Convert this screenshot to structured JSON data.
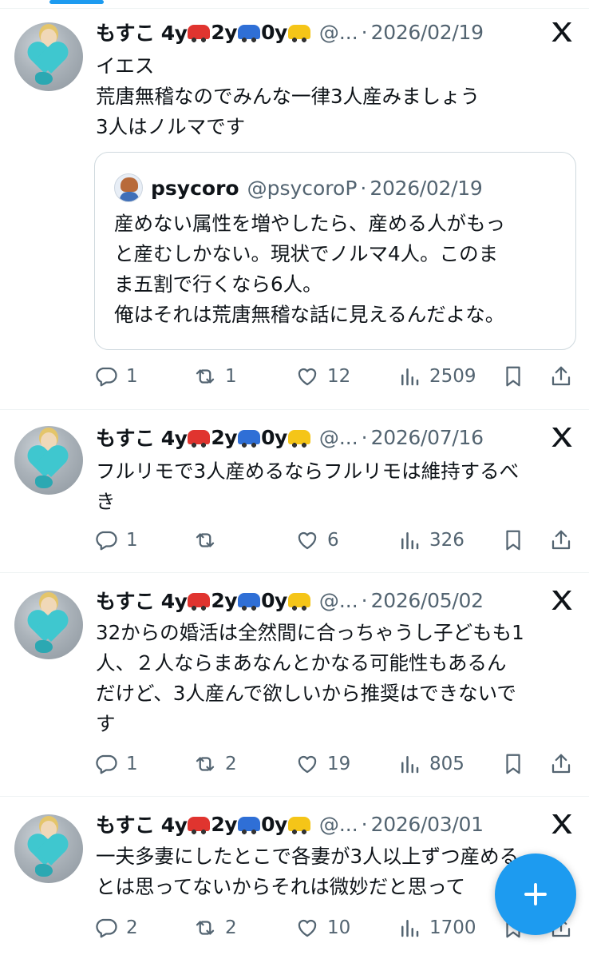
{
  "tweets": [
    {
      "name": "もすこ 4y",
      "name_2y": "2y",
      "name_0y": "0y",
      "handle": "@...",
      "dot": "·",
      "date": "2026/02/19",
      "text": "イエス\n荒唐無稽なのでみんな一律3人産みましょう\n3人はノルマです",
      "quote": {
        "name": "psycoro",
        "handle": "@psycoroP",
        "dot": "·",
        "date": "2026/02/19",
        "text": "産めない属性を増やしたら、産める人がもっ\nと産むしかない。現状でノルマ4人。このま\nま五割で行くなら6人。\n俺はそれは荒唐無稽な話に見えるんだよな。"
      },
      "replies": "1",
      "retweets": "1",
      "likes": "12",
      "views": "2509"
    },
    {
      "name": "もすこ 4y",
      "name_2y": "2y",
      "name_0y": "0y",
      "handle": "@...",
      "dot": "·",
      "date": "2026/07/16",
      "text": "フルリモで3人産めるならフルリモは維持するべ\nき",
      "replies": "1",
      "retweets": "",
      "likes": "6",
      "views": "326"
    },
    {
      "name": "もすこ 4y",
      "name_2y": "2y",
      "name_0y": "0y",
      "handle": "@...",
      "dot": "·",
      "date": "2026/05/02",
      "text": "32からの婚活は全然間に合っちゃうし子どもも1\n人、２人ならまあなんとかなる可能性もあるん\nだけど、3人産んで欲しいから推奨はできないで\nす",
      "replies": "1",
      "retweets": "2",
      "likes": "19",
      "views": "805"
    },
    {
      "name": "もすこ 4y",
      "name_2y": "2y",
      "name_0y": "0y",
      "handle": "@...",
      "dot": "·",
      "date": "2026/03/01",
      "text": "一夫多妻にしたとこで各妻が3人以上ずつ産める\nとは思ってないからそれは微妙だと思って",
      "replies": "2",
      "retweets": "2",
      "likes": "10",
      "views": "1700"
    }
  ],
  "colors": {
    "accent": "#1d9bf0",
    "text": "#0f1419",
    "muted": "#536471",
    "border": "#eff3f4"
  },
  "icons": {
    "reply": "reply-icon",
    "retweet": "retweet-icon",
    "like": "heart-icon",
    "views": "views-icon",
    "bookmark": "bookmark-icon",
    "share": "share-icon",
    "brand": "x-logo-icon",
    "compose": "plus-icon"
  }
}
